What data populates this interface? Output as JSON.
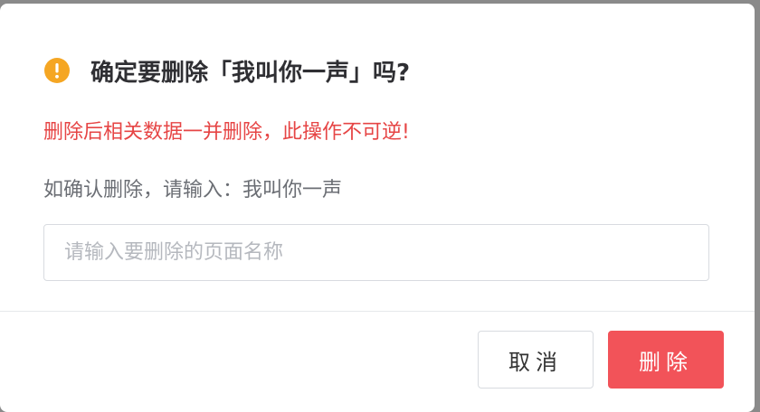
{
  "dialog": {
    "title": "确定要删除「我叫你一声」吗?",
    "warning_icon": "exclamation-circle-icon",
    "danger_message": "删除后相关数据一并删除，此操作不可逆!",
    "confirm_prompt": "如确认删除，请输入：我叫你一声",
    "input": {
      "value": "",
      "placeholder": "请输入要删除的页面名称"
    },
    "buttons": {
      "cancel_label": "取消",
      "delete_label": "删除"
    }
  },
  "colors": {
    "warning": "#f5a623",
    "danger": "#e64545",
    "delete_button": "#f25359"
  }
}
